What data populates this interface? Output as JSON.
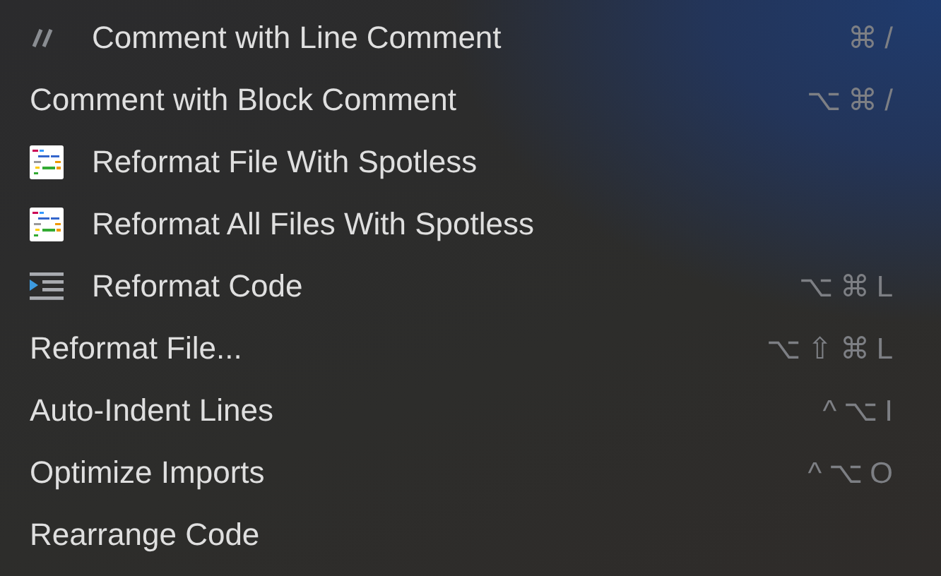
{
  "menu": {
    "items": [
      {
        "kind": "comment",
        "label": "Comment with Line Comment",
        "shortcut": "⌘/"
      },
      {
        "kind": "plain",
        "label": "Comment with Block Comment",
        "shortcut": "⌥⌘/"
      },
      {
        "kind": "spotless",
        "label": "Reformat File With Spotless"
      },
      {
        "kind": "spotless",
        "label": "Reformat All Files With Spotless"
      },
      {
        "kind": "indent",
        "label": "Reformat Code",
        "shortcut": "⌥⌘L"
      },
      {
        "kind": "plain",
        "label": "Reformat File...",
        "shortcut": "⌥⇧⌘L"
      },
      {
        "kind": "plain",
        "label": "Auto-Indent Lines",
        "shortcut": "^⌥I"
      },
      {
        "kind": "plain",
        "label": "Optimize Imports",
        "shortcut": "^⌥O"
      },
      {
        "kind": "plain",
        "label": "Rearrange Code"
      }
    ]
  }
}
